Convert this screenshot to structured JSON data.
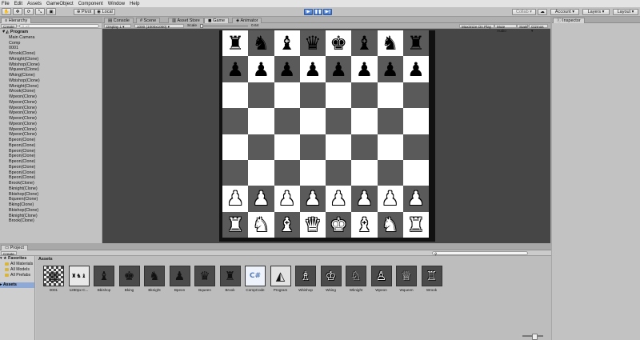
{
  "menu": [
    "File",
    "Edit",
    "Assets",
    "GameObject",
    "Component",
    "Window",
    "Help"
  ],
  "toolbar": {
    "pivot": "Pivot",
    "local": "Local",
    "collab": "Collab",
    "account": "Account",
    "layers": "Layers",
    "layout": "Layout"
  },
  "hierarchy": {
    "tab": "Hierarchy",
    "create": "Create",
    "search_placeholder": "All",
    "root": "Program",
    "items": [
      "Main Camera",
      "Comp",
      "0001",
      "Wrook(Clone)",
      "Wknight(Clone)",
      "Wbishop(Clone)",
      "Wqueen(Clone)",
      "Wking(Clone)",
      "Wbishop(Clone)",
      "Wknight(Clone)",
      "Wrook(Clone)",
      "Wpeon(Clone)",
      "Wpeon(Clone)",
      "Wpeon(Clone)",
      "Wpeon(Clone)",
      "Wpeon(Clone)",
      "Wpeon(Clone)",
      "Wpeon(Clone)",
      "Wpeon(Clone)",
      "Bpeon(Clone)",
      "Bpeon(Clone)",
      "Bpeon(Clone)",
      "Bpeon(Clone)",
      "Bpeon(Clone)",
      "Bpeon(Clone)",
      "Bpeon(Clone)",
      "Bpeon(Clone)",
      "Brook(Clone)",
      "Bknight(Clone)",
      "Bbishop(Clone)",
      "Bqueen(Clone)",
      "Bking(Clone)",
      "Bbishop(Clone)",
      "Bknight(Clone)",
      "Brook(Clone)"
    ]
  },
  "center": {
    "tabs": [
      "Console",
      "Scene",
      "Asset Store",
      "Game",
      "Animator"
    ],
    "active_tab": "Game",
    "display": "Display 1",
    "resolution": "1000 (1000x1000)",
    "scale_label": "Scale",
    "scale_value": "0.64",
    "right_buttons": [
      "Maximize On Play",
      "Mute Audio",
      "Stats",
      "Gizmos"
    ]
  },
  "inspector": {
    "tab": "Inspector"
  },
  "board": [
    [
      "♜",
      "♞",
      "♝",
      "♛",
      "♚",
      "♝",
      "♞",
      "♜"
    ],
    [
      "♟",
      "♟",
      "♟",
      "♟",
      "♟",
      "♟",
      "♟",
      "♟"
    ],
    [
      "",
      "",
      "",
      "",
      "",
      "",
      "",
      ""
    ],
    [
      "",
      "",
      "",
      "",
      "",
      "",
      "",
      ""
    ],
    [
      "",
      "",
      "",
      "",
      "",
      "",
      "",
      ""
    ],
    [
      "",
      "",
      "",
      "",
      "",
      "",
      "",
      ""
    ],
    [
      "♟",
      "♟",
      "♟",
      "♟",
      "♟",
      "♟",
      "♟",
      "♟"
    ],
    [
      "♜",
      "♞",
      "♝",
      "♛",
      "♚",
      "♝",
      "♞",
      "♜"
    ]
  ],
  "board_colors": {
    "light": "#ffffff",
    "dark": "#5a5a5a",
    "frame": "#111111"
  },
  "project": {
    "tab": "Project",
    "create": "Create",
    "favorites": "Favorites",
    "favorite_items": [
      "All Materials",
      "All Models",
      "All Prefabs"
    ],
    "assets_root": "Assets",
    "breadcrumb": "Assets",
    "assets": [
      {
        "name": "0001",
        "icon": "▦"
      },
      {
        "name": "1280px-C...",
        "icon": "♜♞♝"
      },
      {
        "name": "Bbishop",
        "icon": "♝"
      },
      {
        "name": "Bking",
        "icon": "♚"
      },
      {
        "name": "Bknight",
        "icon": "♞"
      },
      {
        "name": "Bpeon",
        "icon": "♟"
      },
      {
        "name": "Bqueen",
        "icon": "♛"
      },
      {
        "name": "Brook",
        "icon": "♜"
      },
      {
        "name": "CompCode",
        "icon": "C#"
      },
      {
        "name": "Program",
        "icon": "◭"
      },
      {
        "name": "Wbishop",
        "icon": "♗"
      },
      {
        "name": "Wking",
        "icon": "♔"
      },
      {
        "name": "Wknight",
        "icon": "♘"
      },
      {
        "name": "Wpeon",
        "icon": "♙"
      },
      {
        "name": "Wqueen",
        "icon": "♕"
      },
      {
        "name": "Wrook",
        "icon": "♖"
      }
    ]
  }
}
